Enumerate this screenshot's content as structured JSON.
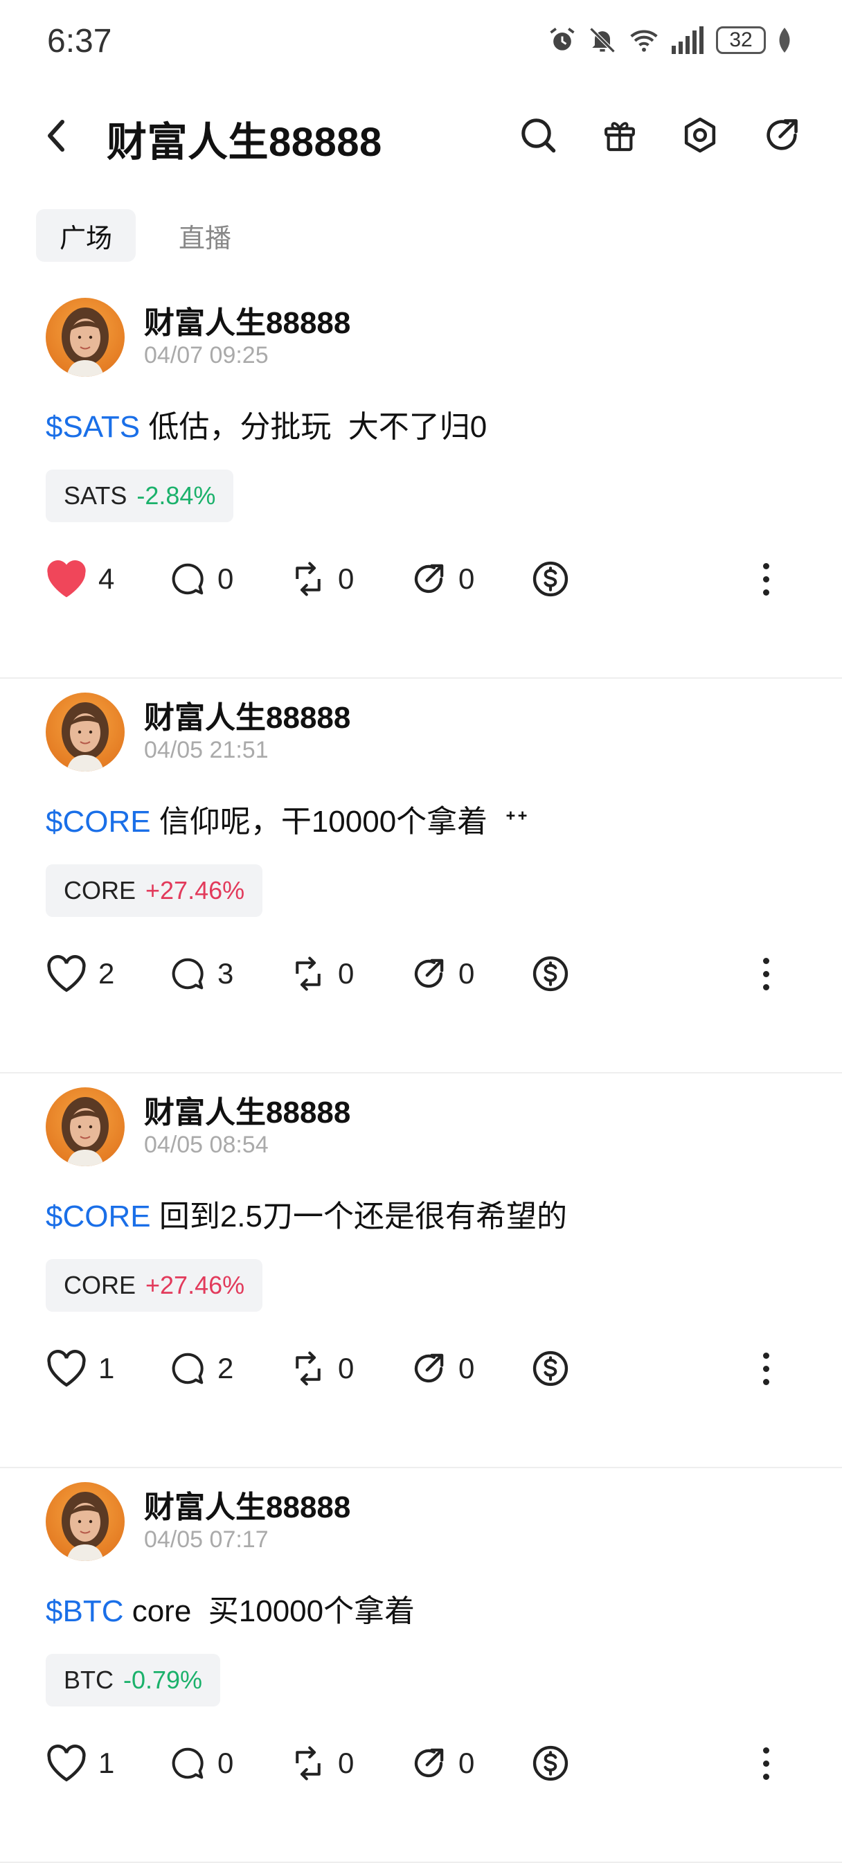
{
  "status_bar": {
    "time": "6:37",
    "battery": "32"
  },
  "header": {
    "title": "财富人生88888"
  },
  "tabs": [
    {
      "label": "广场"
    },
    {
      "label": "直播"
    }
  ],
  "colors": {
    "up": "#e23a5b",
    "down": "#1bb16b",
    "link": "#1a6fe8",
    "liked": "#f0465a"
  },
  "posts": [
    {
      "author": "财富人生88888",
      "time": "04/07 09:25",
      "ticker": "$SATS",
      "text": " 低估，分批玩  大不了归0",
      "chip": {
        "symbol": "SATS",
        "change": "-2.84%",
        "direction": "down"
      },
      "likes": "4",
      "liked": true,
      "comments": "0",
      "reposts": "0",
      "shares": "0"
    },
    {
      "author": "财富人生88888",
      "time": "04/05 21:51",
      "ticker": "$CORE",
      "text": " 信仰呢，干10000个拿着  ᐩᐩ",
      "chip": {
        "symbol": "CORE",
        "change": "+27.46%",
        "direction": "up"
      },
      "likes": "2",
      "liked": false,
      "comments": "3",
      "reposts": "0",
      "shares": "0"
    },
    {
      "author": "财富人生88888",
      "time": "04/05 08:54",
      "ticker": "$CORE",
      "text": " 回到2.5刀一个还是很有希望的",
      "chip": {
        "symbol": "CORE",
        "change": "+27.46%",
        "direction": "up"
      },
      "likes": "1",
      "liked": false,
      "comments": "2",
      "reposts": "0",
      "shares": "0"
    },
    {
      "author": "财富人生88888",
      "time": "04/05 07:17",
      "ticker": "$BTC",
      "text": " core  买10000个拿着",
      "chip": {
        "symbol": "BTC",
        "change": "-0.79%",
        "direction": "down"
      },
      "likes": "1",
      "liked": false,
      "comments": "0",
      "reposts": "0",
      "shares": "0"
    }
  ]
}
